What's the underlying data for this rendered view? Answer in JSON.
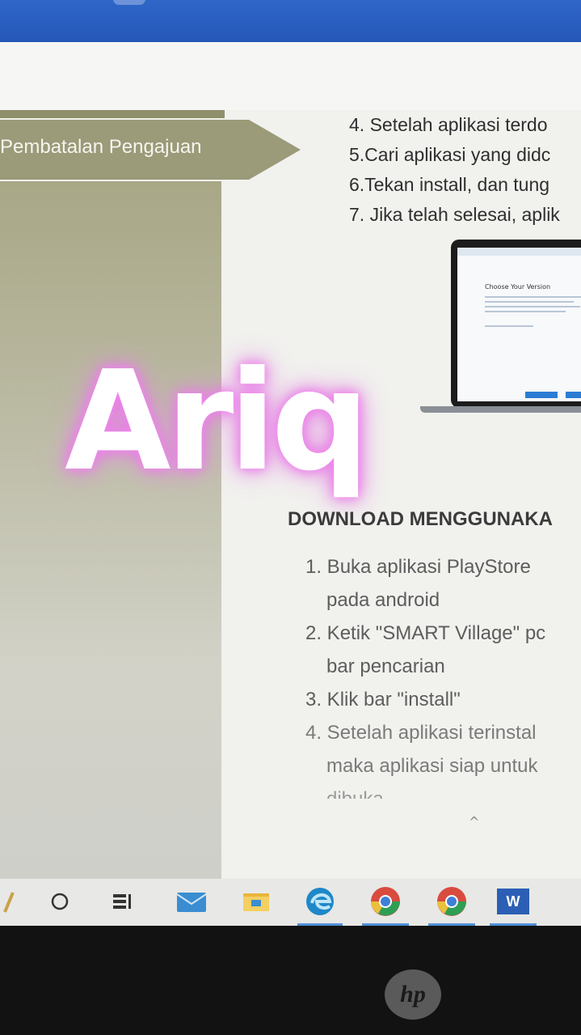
{
  "doc": {
    "banner_label": "Pembatalan Pengajuan",
    "steps": [
      "4. Setelah aplikasi terdo",
      "5.Cari aplikasi yang didc",
      "6.Tekan install, dan tung",
      "7. Jika telah selesai, aplik"
    ],
    "laptop_screen_title": "Choose Your Version",
    "watermark": "Ariq",
    "download_title": "DOWNLOAD MENGGUNAKA",
    "download_steps": [
      "1. Buka aplikasi PlayStore",
      "pada android",
      "2. Ketik \"SMART Village\" pc",
      "bar pencarian",
      "3. Klik bar \"install\"",
      "4. Setelah aplikasi terinstal",
      "maka aplikasi siap untuk",
      "dibuka"
    ]
  },
  "taskbar": {
    "icons": [
      "search-icon",
      "task-view-icon",
      "multitasking-icon",
      "mail-icon",
      "file-explorer-icon",
      "edge-icon",
      "chrome-icon",
      "chrome-icon",
      "word-icon"
    ],
    "word_letter": "W"
  },
  "hardware": {
    "logo": "hp"
  },
  "colors": {
    "olive": "#9b9a79",
    "watermark_glow": "#e36de0",
    "taskbar_accent": "#4f8fd6"
  }
}
